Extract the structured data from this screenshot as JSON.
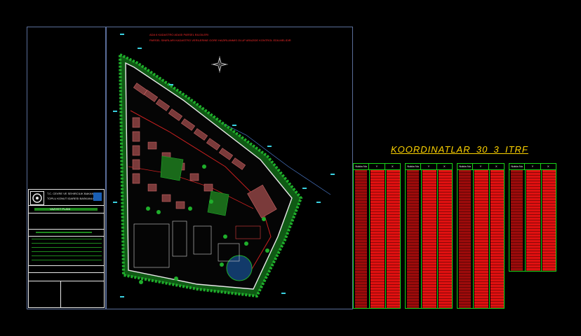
{
  "notes": {
    "line1": "ADA 6 KADASTRO ADASI PARSEL BILGILERI",
    "line2": "PARSEL SINIRLARI KADASTRO VERILERINE GORE HAZIRLANMIS OLUP ARAZIDE KONTROL EDILMELIDIR"
  },
  "coordinates": {
    "title": "KOORDINATLAR_30_3_ITRF",
    "headers": [
      "Nokta No",
      "Y",
      "X"
    ]
  },
  "title_block": {
    "org_line1": "T.C. CEVRE VE SEHIRCILIK BAKANLIGI",
    "org_line2": "TOPLU KONUT IDARESI BASKANLIGI",
    "project": "VAZIYET PLANI",
    "colors": {
      "frame": "#e8e8e8",
      "band": "#1e8a1e",
      "logo_bg": "#1a5fb4"
    }
  },
  "colors": {
    "sheet_border": "#5a6e9a",
    "table_grid": "#19d219",
    "table_values": "#e01010",
    "coord_title": "#ffd400",
    "site_boundary": "#e8e8e8",
    "vegetation": "#1fae2b",
    "buildings": "#c85a5a"
  }
}
